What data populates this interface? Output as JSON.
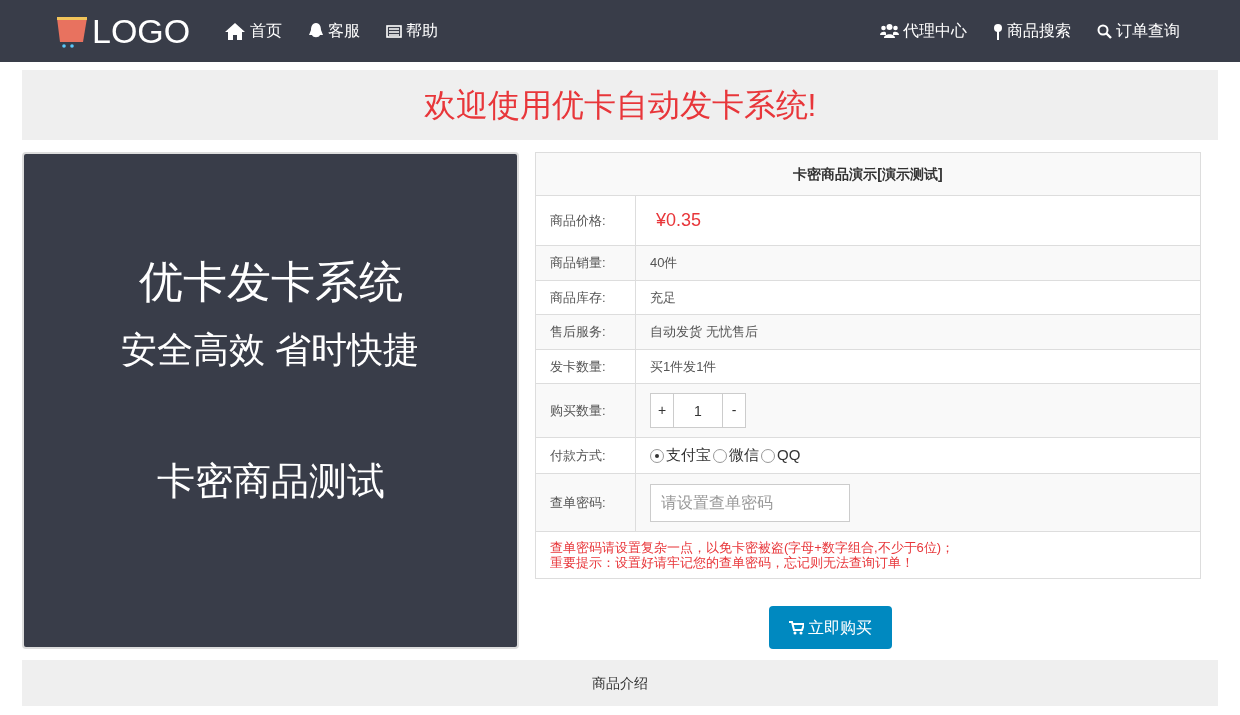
{
  "nav": {
    "logo": "LOGO",
    "left": [
      {
        "label": "首页",
        "kind": "home"
      },
      {
        "label": "客服",
        "kind": "chat"
      },
      {
        "label": "帮助",
        "kind": "card"
      }
    ],
    "right": [
      {
        "label": "代理中心",
        "kind": "users"
      },
      {
        "label": "商品搜索",
        "kind": "pin"
      },
      {
        "label": "订单查询",
        "kind": "search"
      }
    ]
  },
  "banner": "欢迎使用优卡自动发卡系统!",
  "product_image": {
    "lines": [
      "优卡发卡系统",
      "安全高效 省时快捷",
      "卡密商品测试"
    ]
  },
  "product": {
    "title": "卡密商品演示[演示测试]",
    "rows": [
      {
        "kind": "price",
        "label": "商品价格:",
        "value": "¥0.35"
      },
      {
        "kind": "text",
        "label": "商品销量:",
        "value": "40件"
      },
      {
        "kind": "text",
        "label": "商品库存:",
        "value": "充足"
      },
      {
        "kind": "text",
        "label": "售后服务:",
        "value": "自动发货 无忧售后"
      },
      {
        "kind": "text",
        "label": "发卡数量:",
        "value": "买1件发1件"
      },
      {
        "kind": "quantity",
        "label": "购买数量:",
        "plus": "+",
        "value": "1",
        "minus": "-"
      },
      {
        "kind": "payment",
        "label": "付款方式:",
        "options": [
          {
            "label": "支付宝",
            "selected": true
          },
          {
            "label": "微信",
            "selected": false
          },
          {
            "label": "QQ",
            "selected": false
          }
        ]
      },
      {
        "kind": "password",
        "label": "查单密码:",
        "placeholder": "请设置查单密码"
      }
    ],
    "notes": [
      "查单密码请设置复杂一点，以免卡密被盗(字母+数字组合,不少于6位)；",
      "重要提示：设置好请牢记您的查单密码，忘记则无法查询订单！"
    ]
  },
  "buy_button": "立即购买",
  "intro_heading": "商品介绍"
}
